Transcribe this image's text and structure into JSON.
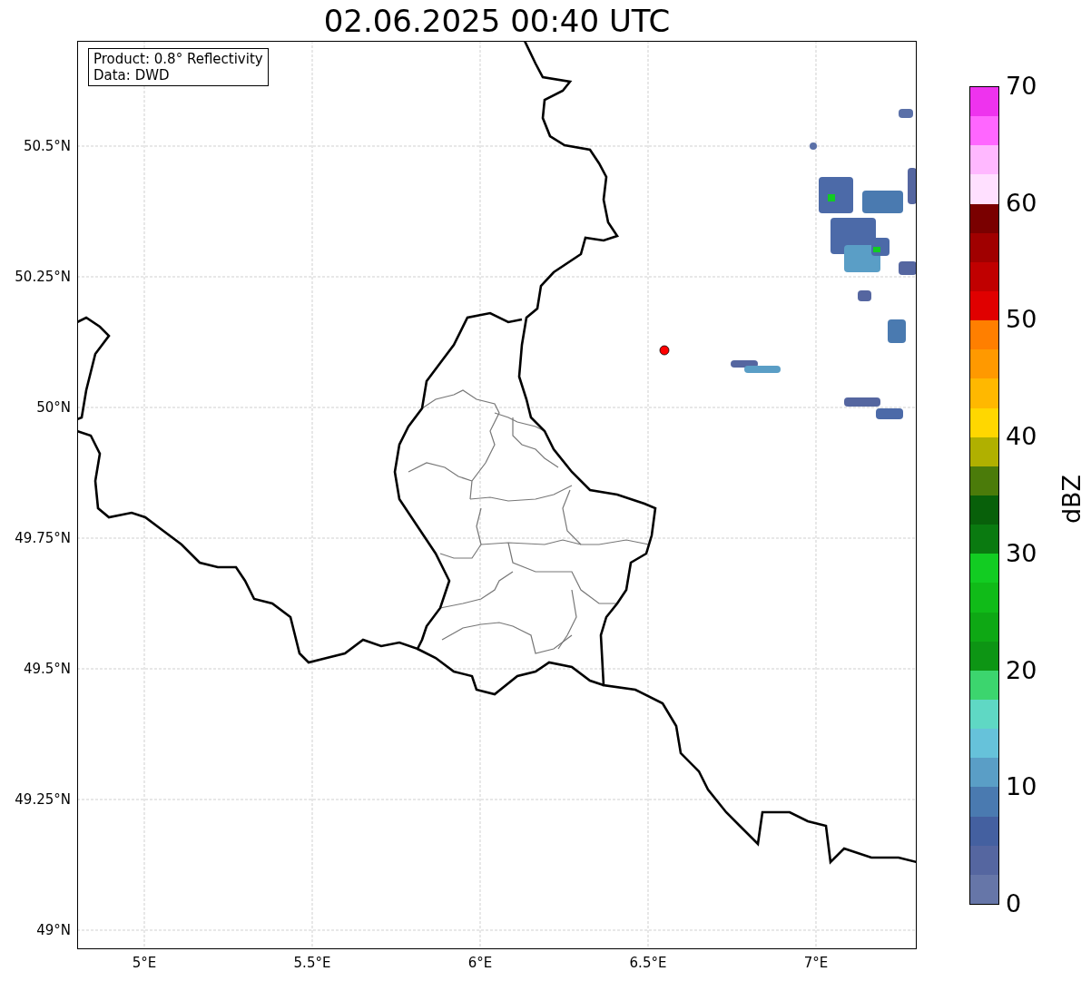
{
  "title": "02.06.2025 00:40 UTC",
  "info_box": [
    "Product: 0.8° Reflectivity",
    "Data: DWD"
  ],
  "y_ticks": [
    "50.5°N",
    "50.25°N",
    "50°N",
    "49.75°N",
    "49.5°N",
    "49.25°N",
    "49°N"
  ],
  "x_ticks": [
    "5°E",
    "5.5°E",
    "6°E",
    "6.5°E",
    "7°E"
  ],
  "colorbar": {
    "label": "dBZ",
    "ticks": [
      "70",
      "60",
      "50",
      "40",
      "30",
      "20",
      "10",
      "0"
    ],
    "segments": [
      {
        "color": "#6676a8"
      },
      {
        "color": "#5566a0"
      },
      {
        "color": "#4460a0"
      },
      {
        "color": "#4a7ab0"
      },
      {
        "color": "#5a9ec6"
      },
      {
        "color": "#66c2da"
      },
      {
        "color": "#5fd8c4"
      },
      {
        "color": "#3cd56e"
      },
      {
        "color": "#0d9514"
      },
      {
        "color": "#0ea814"
      },
      {
        "color": "#10bb18"
      },
      {
        "color": "#12cc22"
      },
      {
        "color": "#0a7a10"
      },
      {
        "color": "#08600a"
      },
      {
        "color": "#4b7b0a"
      },
      {
        "color": "#b0b000"
      },
      {
        "color": "#ffd700"
      },
      {
        "color": "#ffb800"
      },
      {
        "color": "#ff9900"
      },
      {
        "color": "#ff7f00"
      },
      {
        "color": "#e00000"
      },
      {
        "color": "#c00000"
      },
      {
        "color": "#a00000"
      },
      {
        "color": "#7a0000"
      },
      {
        "color": "#ffe0ff"
      },
      {
        "color": "#ffb8ff"
      },
      {
        "color": "#ff66ff"
      },
      {
        "color": "#ee33ee"
      }
    ]
  }
}
